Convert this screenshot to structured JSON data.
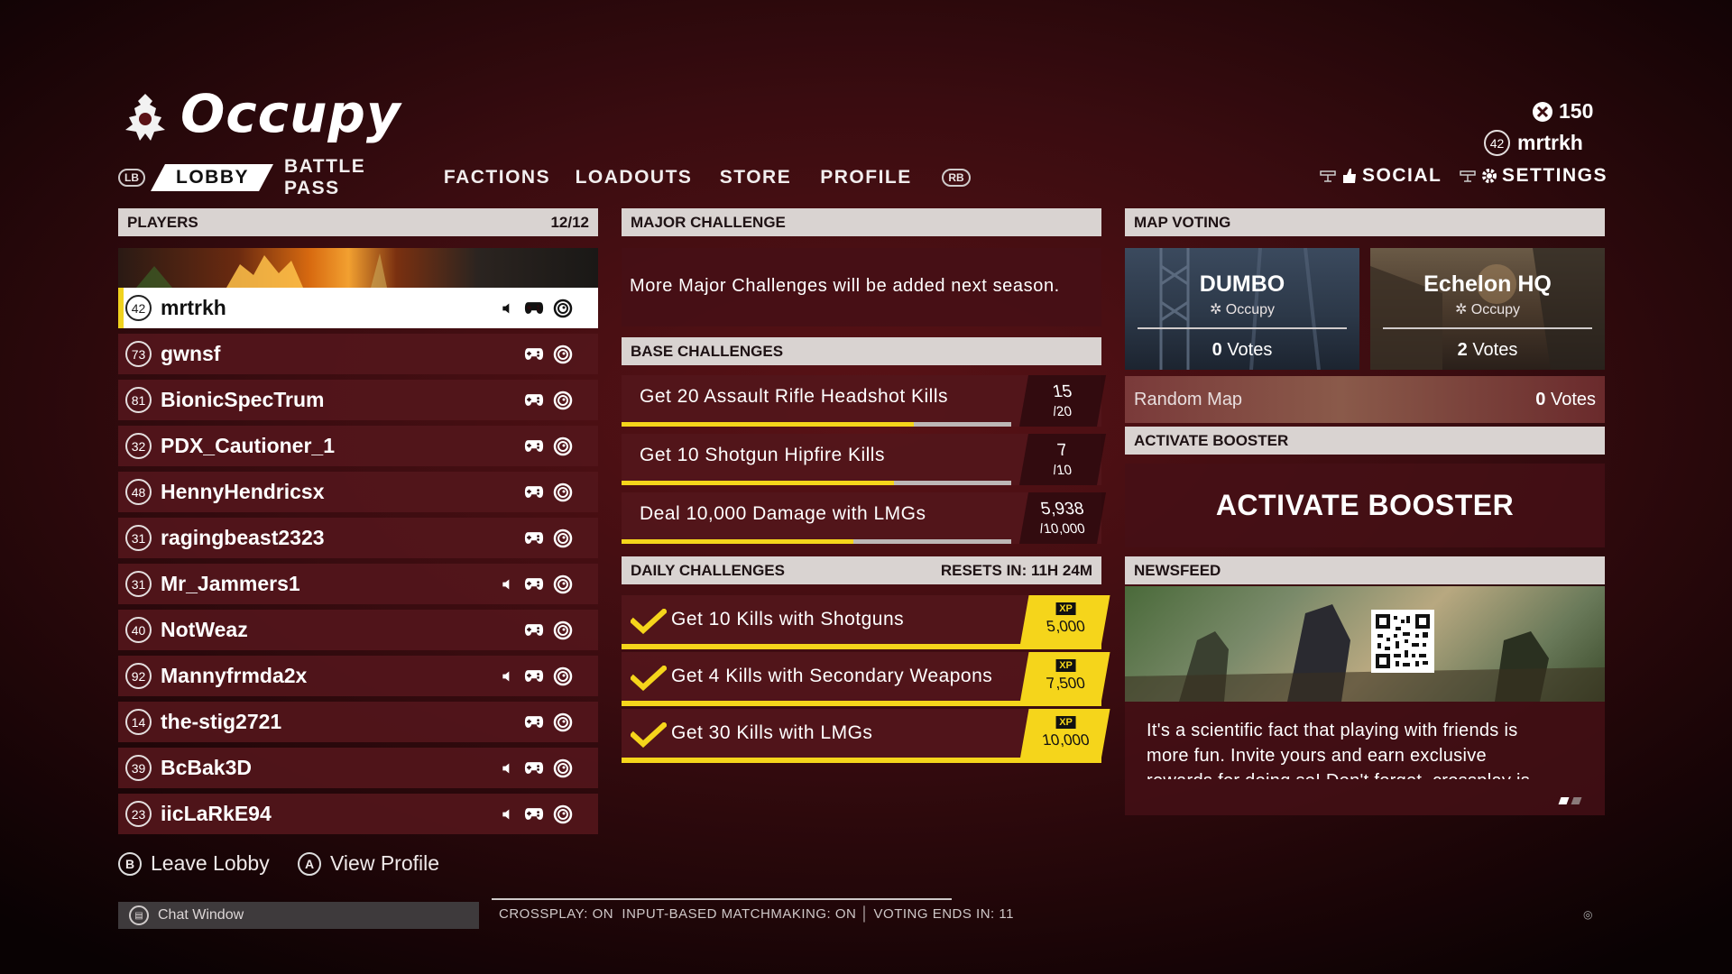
{
  "header": {
    "title": "Occupy",
    "currency": "150",
    "user_level": "42",
    "username": "mrtrkh"
  },
  "nav": {
    "lb": "LB",
    "rb": "RB",
    "tabs": [
      "LOBBY",
      "BATTLE PASS",
      "FACTIONS",
      "LOADOUTS",
      "STORE",
      "PROFILE"
    ],
    "social": "SOCIAL",
    "settings": "SETTINGS"
  },
  "players": {
    "header": "PLAYERS",
    "count": "12/12",
    "list": [
      {
        "level": "42",
        "name": "mrtrkh",
        "speaker": true
      },
      {
        "level": "73",
        "name": "gwnsf",
        "speaker": false
      },
      {
        "level": "81",
        "name": "BionicSpecTrum",
        "speaker": false
      },
      {
        "level": "32",
        "name": "PDX_Cautioner_1",
        "speaker": false
      },
      {
        "level": "48",
        "name": "HennyHendricsx",
        "speaker": false
      },
      {
        "level": "31",
        "name": "ragingbeast2323",
        "speaker": false
      },
      {
        "level": "31",
        "name": "Mr_Jammers1",
        "speaker": true
      },
      {
        "level": "40",
        "name": "NotWeaz",
        "speaker": false
      },
      {
        "level": "92",
        "name": "Mannyfrmda2x",
        "speaker": true
      },
      {
        "level": "14",
        "name": "the-stig2721",
        "speaker": false
      },
      {
        "level": "39",
        "name": "BcBak3D",
        "speaker": true
      },
      {
        "level": "23",
        "name": "iicLaRkE94",
        "speaker": true
      }
    ]
  },
  "major": {
    "header": "MAJOR CHALLENGE",
    "text": "More Major Challenges will be added next season."
  },
  "base": {
    "header": "BASE CHALLENGES",
    "items": [
      {
        "text": "Get 20 Assault Rifle Headshot Kills",
        "current": "15",
        "total": "/20",
        "progress": 0.75
      },
      {
        "text": "Get 10 Shotgun Hipfire Kills",
        "current": "7",
        "total": "/10",
        "progress": 0.7
      },
      {
        "text": "Deal 10,000 Damage with LMGs",
        "current": "5,938",
        "total": "/10,000",
        "progress": 0.5938
      }
    ]
  },
  "daily": {
    "header": "DAILY CHALLENGES",
    "resets": "RESETS IN: 11H 24M",
    "items": [
      {
        "text": "Get 10 Kills with Shotguns",
        "xp_label": "XP",
        "xp": "5,000"
      },
      {
        "text": "Get 4 Kills with Secondary Weapons",
        "xp_label": "XP",
        "xp": "7,500"
      },
      {
        "text": "Get 30 Kills with LMGs",
        "xp_label": "XP",
        "xp": "10,000"
      }
    ]
  },
  "map_voting": {
    "header": "MAP VOTING",
    "maps": [
      {
        "name": "DUMBO",
        "mode": "Occupy",
        "votes_num": "0",
        "votes_label": "Votes"
      },
      {
        "name": "Echelon HQ",
        "mode": "Occupy",
        "votes_num": "2",
        "votes_label": "Votes"
      }
    ],
    "random": {
      "name": "Random Map",
      "votes_num": "0",
      "votes_label": "Votes"
    }
  },
  "booster": {
    "header": "ACTIVATE BOOSTER",
    "button": "ACTIVATE BOOSTER"
  },
  "newsfeed": {
    "header": "NEWSFEED",
    "text_line1": "It's a scientific fact that playing with friends is",
    "text_line2": "more fun. Invite yours and earn exclusive",
    "text_line3": "rewards for doing so! Don't forget, crossplay is",
    "page": 1,
    "pages": 2
  },
  "footer": {
    "leave_btn": "B",
    "leave": "Leave Lobby",
    "view_btn": "A",
    "view": "View Profile",
    "chat": "Chat Window",
    "status": "CROSSPLAY: ON  INPUT-BASED MATCHMAKING: ON │ VOTING ENDS IN: 11"
  },
  "colors": {
    "accent_yellow": "#f5d51b",
    "panel": "#52161b",
    "header_bar": "#d9d3d1"
  },
  "icons": [
    "occupy-emblem-icon",
    "currency-icon",
    "social-icon",
    "settings-gear-icon",
    "speaker-icon",
    "controller-icon",
    "ubisoft-icon",
    "check-icon",
    "qr-code-icon"
  ]
}
